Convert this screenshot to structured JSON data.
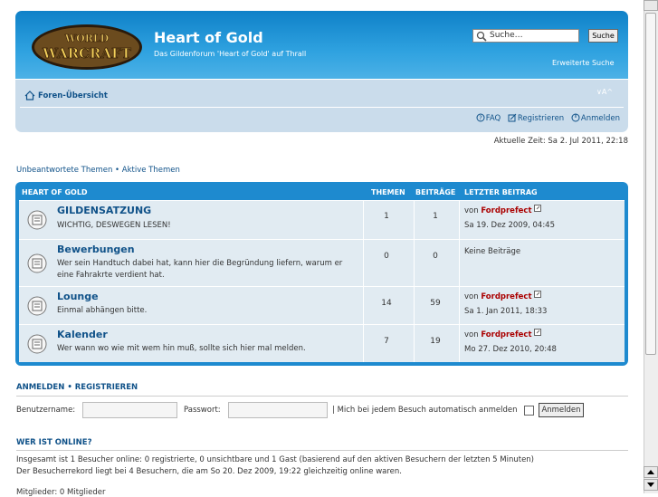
{
  "header": {
    "logo_text_top": "WORLD",
    "logo_text_bottom": "WARCRAFT",
    "site_title": "Heart of Gold",
    "site_description": "Das Gildenforum 'Heart of Gold' auf Thrall",
    "search_placeholder": "Suche…",
    "search_button": "Suche",
    "advanced_search": "Erweiterte Suche"
  },
  "navbar": {
    "home_label": "Foren-Übersicht",
    "font_size_control": "∨A^",
    "links": [
      {
        "icon": "faq-icon",
        "label": "FAQ"
      },
      {
        "icon": "register-icon",
        "label": "Registrieren"
      },
      {
        "icon": "login-icon",
        "label": "Anmelden"
      }
    ]
  },
  "current_time": "Aktuelle Zeit: Sa 2. Jul 2011, 22:18",
  "quick_links": {
    "unanswered": "Unbeantwortete Themen",
    "separator": "•",
    "active": "Aktive Themen"
  },
  "forum_table": {
    "category": "HEART OF GOLD",
    "col_topics": "THEMEN",
    "col_posts": "BEITRÄGE",
    "col_last": "LETZTER BEITRAG",
    "forums": [
      {
        "name": "GILDENSATZUNG",
        "description": "WICHTIG, DESWEGEN LESEN!",
        "topics": "1",
        "posts": "1",
        "last_prefix": "von",
        "last_author": "Fordprefect",
        "last_date": "Sa 19. Dez 2009, 04:45"
      },
      {
        "name": "Bewerbungen",
        "description": "Wer sein Handtuch dabei hat, kann hier die Begründung liefern, warum er eine Fahrakrte verdient hat.",
        "topics": "0",
        "posts": "0",
        "no_posts": "Keine Beiträge"
      },
      {
        "name": "Lounge",
        "description": "Einmal abhängen bitte.",
        "topics": "14",
        "posts": "59",
        "last_prefix": "von",
        "last_author": "Fordprefect",
        "last_date": "Sa 1. Jan 2011, 18:33"
      },
      {
        "name": "Kalender",
        "description": "Wer wann wo wie mit wem hin muß, sollte sich hier mal melden.",
        "topics": "7",
        "posts": "19",
        "last_prefix": "von",
        "last_author": "Fordprefect",
        "last_date": "Mo 27. Dez 2010, 20:48"
      }
    ]
  },
  "login": {
    "title_login": "ANMELDEN",
    "title_sep": "•",
    "title_register": "REGISTRIEREN",
    "username_label": "Benutzername:",
    "password_label": "Passwort:",
    "autologin_label": "| Mich bei jedem Besuch automatisch anmelden",
    "login_button": "Anmelden"
  },
  "online": {
    "title": "WER IST ONLINE?",
    "line1": "Insgesamt ist 1 Besucher online: 0 registrierte, 0 unsichtbare und 1 Gast (basierend auf den aktiven Besuchern der letzten 5 Minuten)",
    "line2": "Der Besucherrekord liegt bei 4 Besuchern, die am So 20. Dez 2009, 19:22 gleichzeitig online waren.",
    "members_cut": "Mitglieder: 0 Mitglieder"
  },
  "colors": {
    "header_blue": "#1e8acf",
    "row_bg": "#e1ebf2",
    "link": "#105289",
    "author_red": "#aa0000"
  }
}
